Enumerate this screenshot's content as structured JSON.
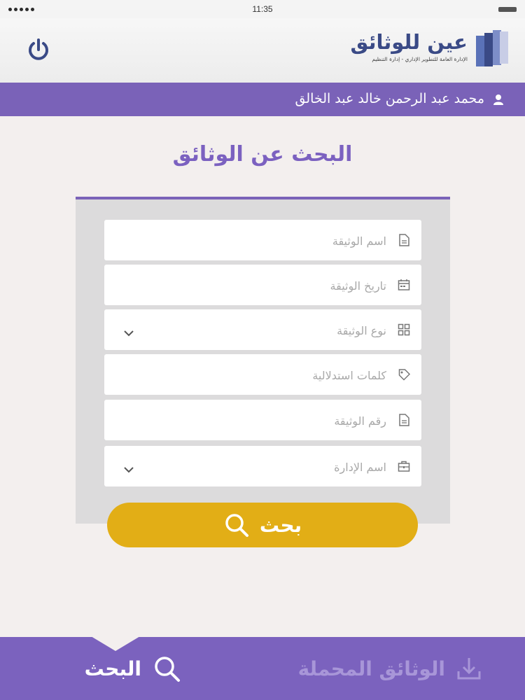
{
  "status_bar": {
    "time": "11:35"
  },
  "header": {
    "logo_title": "عين للوثائق",
    "logo_subtitle": "الإدارة العامة للتطوير الإداري - إدارة التنظيم"
  },
  "user": {
    "name": "محمد عبد الرحمن خالد عبد الخالق"
  },
  "page": {
    "title": "البحث عن الوثائق"
  },
  "form": {
    "fields": [
      {
        "placeholder": "اسم الوثيقة",
        "icon": "document-icon",
        "type": "text"
      },
      {
        "placeholder": "تاريخ الوثيقة",
        "icon": "calendar-icon",
        "type": "text"
      },
      {
        "placeholder": "نوع الوثيقة",
        "icon": "grid-icon",
        "type": "select"
      },
      {
        "placeholder": "كلمات استدلالية",
        "icon": "tag-icon",
        "type": "text"
      },
      {
        "placeholder": "رقم الوثيقة",
        "icon": "document-icon",
        "type": "text"
      },
      {
        "placeholder": "اسم الإدارة",
        "icon": "briefcase-icon",
        "type": "select"
      }
    ],
    "submit_label": "بحث"
  },
  "bottom_nav": {
    "search_label": "البحث",
    "downloads_label": "الوثائق المحملة",
    "active_tab": "search"
  },
  "colors": {
    "purple": "#7a62b8",
    "title_purple": "#7b61c0",
    "button_yellow": "#e2ae16",
    "logo_navy": "#3a4a86"
  }
}
